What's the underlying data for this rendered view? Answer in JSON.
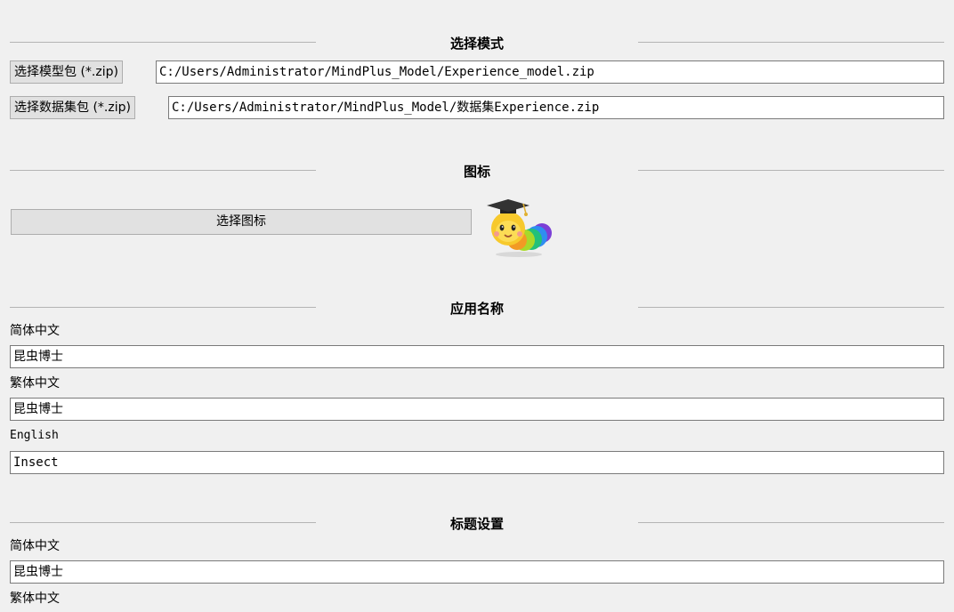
{
  "mode_section": {
    "title": "选择模式",
    "model_button": "选择模型包 (*.zip)",
    "model_path": "C:/Users/Administrator/MindPlus_Model/Experience_model.zip",
    "dataset_button": "选择数据集包 (*.zip)",
    "dataset_path": "C:/Users/Administrator/MindPlus_Model/数据集Experience.zip"
  },
  "icon_section": {
    "title": "图标",
    "select_button": "选择图标",
    "preview_icon": "caterpillar-graduate-icon"
  },
  "app_name_section": {
    "title": "应用名称",
    "simplified_label": "简体中文",
    "simplified_value": "昆虫博士",
    "traditional_label": "繁体中文",
    "traditional_value": "昆虫博士",
    "english_label": "English",
    "english_value": "Insect"
  },
  "title_section": {
    "title": "标题设置",
    "simplified_label": "简体中文",
    "simplified_value": "昆虫博士",
    "traditional_label": "繁体中文"
  }
}
